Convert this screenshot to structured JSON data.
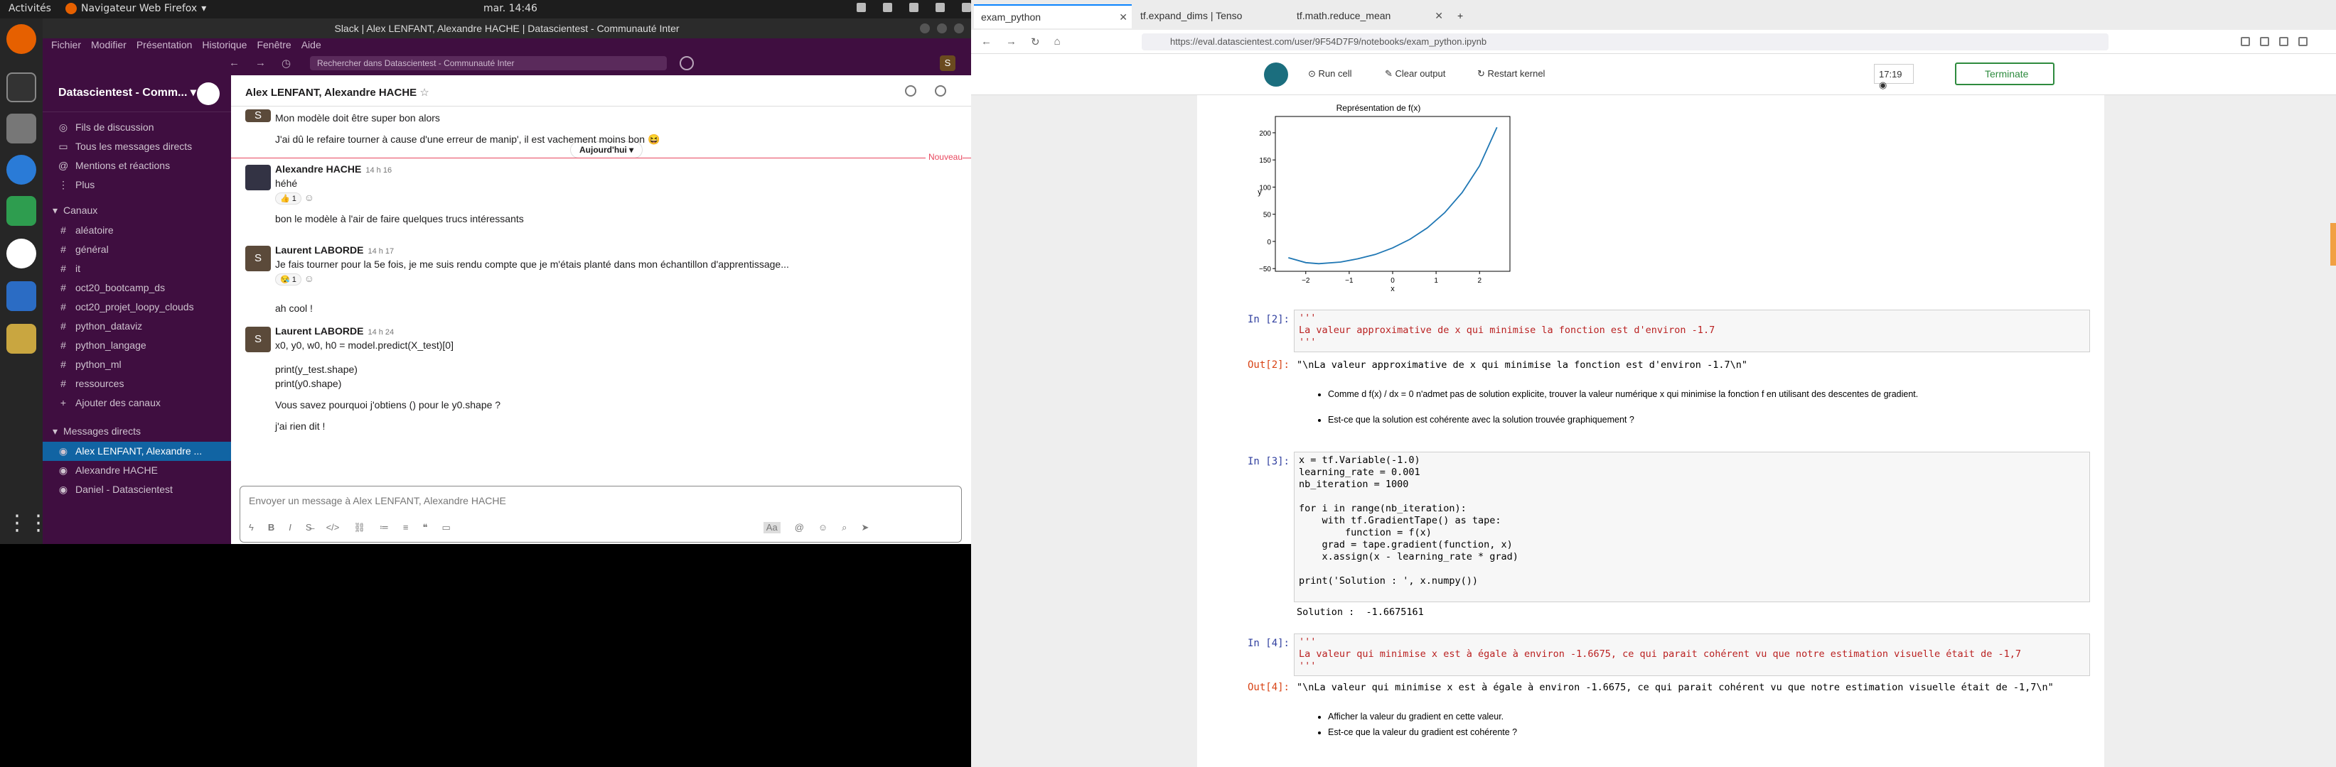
{
  "system": {
    "activities": "Activités",
    "firefox_menu": "Navigateur Web Firefox",
    "clock": "mar. 14:46"
  },
  "slack": {
    "window_title": "Slack | Alex LENFANT, Alexandre HACHE | Datascientest - Communauté Inter",
    "menu": [
      "Fichier",
      "Modifier",
      "Présentation",
      "Historique",
      "Fenêtre",
      "Aide"
    ],
    "search_placeholder": "Rechercher dans Datascientest - Communauté Inter",
    "user_initial": "S",
    "workspace": "Datascientest - Comm...",
    "nav_items": [
      "Fils de discussion",
      "Tous les messages directs",
      "Mentions et réactions",
      "Plus"
    ],
    "channels_header": "Canaux",
    "channels": [
      "aléatoire",
      "général",
      "it",
      "oct20_bootcamp_ds",
      "oct20_projet_loopy_clouds",
      "python_dataviz",
      "python_langage",
      "python_ml",
      "ressources"
    ],
    "add_channels": "Ajouter des canaux",
    "dm_header": "Messages directs",
    "dms": [
      "Alex LENFANT, Alexandre ...",
      "Alexandre HACHE",
      "Daniel - Datascientest"
    ],
    "channel_title": "Alex LENFANT, Alexandre HACHE",
    "date_pill": "Aujourd'hui",
    "new_label": "Nouveau",
    "messages": [
      {
        "author": "",
        "time": "",
        "lines": [
          "Mon modèle doit être super bon alors"
        ]
      },
      {
        "author": "",
        "time": "",
        "lines": [
          "J'ai dû le refaire tourner à cause d'une erreur de manip', il est vachement moins bon 😆"
        ]
      },
      {
        "author": "Alexandre HACHE",
        "time": "14 h 16",
        "lines": [
          "héhé"
        ],
        "reaction": "👍 1"
      },
      {
        "author": "",
        "time": "",
        "lines": [
          "bon le modèle à l'air de faire quelques trucs intéressants"
        ]
      },
      {
        "author": "Laurent LABORDE",
        "time": "14 h 17",
        "lines": [
          "Je fais tourner pour la 5e fois, je me suis rendu compte que je m'étais planté dans mon échantillon d'apprentissage..."
        ],
        "reaction": "😪 1"
      },
      {
        "author": "",
        "time": "",
        "lines": [
          "ah cool !"
        ]
      },
      {
        "author": "Laurent LABORDE",
        "time": "14 h 24",
        "lines": [
          "x0, y0, w0, h0 = model.predict(X_test)[0]"
        ]
      },
      {
        "author": "",
        "time": "",
        "lines": [
          "print(y_test.shape)",
          "print(y0.shape)"
        ]
      },
      {
        "author": "",
        "time": "",
        "lines": [
          "Vous savez pourquoi j'obtiens () pour le y0.shape ?"
        ]
      },
      {
        "author": "",
        "time": "",
        "lines": [
          "j'ai rien dit !"
        ]
      }
    ],
    "composer_placeholder": "Envoyer un message à Alex LENFANT, Alexandre HACHE",
    "format_label": "Aa"
  },
  "firefox": {
    "tabs": [
      "exam_python",
      "tf.expand_dims  |  Tenso",
      "tf.math.reduce_mean"
    ],
    "url": "https://eval.datascientest.com/user/9F54D7F9/notebooks/exam_python.ipynb"
  },
  "jupyter": {
    "run_cell": "Run cell",
    "clear_output": "Clear output",
    "restart_kernel": "Restart kernel",
    "timer": "17:19",
    "terminate": "Terminate",
    "cells": {
      "c2_prompt": "In [2]:",
      "c2_code": [
        "'''",
        "La valeur approximative de x qui minimise la fonction est d'environ -1.7",
        "'''"
      ],
      "o2_prompt": "Out[2]:",
      "o2_text": "\"\\nLa valeur approximative de x qui minimise la fonction est d'environ -1.7\\n\"",
      "md1": [
        "Comme d f(x) / dx = 0 n'admet pas de solution explicite, trouver la valeur numérique x qui minimise la fonction f en utilisant des descentes de gradient.",
        "Est-ce que la solution est cohérente avec la solution trouvée graphiquement ?"
      ],
      "c3_prompt": "In [3]:",
      "c3_code": [
        "x = tf.Variable(-1.0)",
        "learning_rate = 0.001",
        "nb_iteration = 1000",
        "",
        "for i in range(nb_iteration):",
        "    with tf.GradientTape() as tape:",
        "        function = f(x)",
        "    grad = tape.gradient(function, x)",
        "    x.assign(x - learning_rate * grad)",
        "",
        "print('Solution : ', x.numpy())"
      ],
      "o3_text": "Solution :  -1.6675161",
      "c4_prompt": "In [4]:",
      "c4_code": [
        "'''",
        "La valeur qui minimise x est à égale à environ -1.6675, ce qui parait cohérent vu que notre estimation visuelle était de -1,7",
        "'''"
      ],
      "o4_prompt": "Out[4]:",
      "o4_text": "\"\\nLa valeur qui minimise x est à égale à environ -1.6675, ce qui parait cohérent vu que notre estimation visuelle était de -1,7\\n\"",
      "md2": [
        "Afficher la valeur du gradient en cette valeur.",
        "Est-ce que la valeur du gradient est cohérente ?"
      ]
    }
  },
  "chart_data": {
    "type": "line",
    "title": "Représentation de f(x)",
    "xlabel": "x",
    "ylabel": "y",
    "xlim": [
      -2.7,
      2.7
    ],
    "ylim": [
      -55,
      230
    ],
    "xticks": [
      -2,
      -1,
      0,
      1,
      2
    ],
    "yticks": [
      -50,
      0,
      50,
      100,
      150,
      200
    ],
    "x": [
      -2.4,
      -2.0,
      -1.7,
      -1.2,
      -0.8,
      -0.4,
      0,
      0.4,
      0.8,
      1.2,
      1.6,
      2.0,
      2.4
    ],
    "y": [
      -30,
      -39,
      -41,
      -38,
      -32,
      -24,
      -12,
      4,
      25,
      53,
      90,
      139,
      210
    ]
  }
}
